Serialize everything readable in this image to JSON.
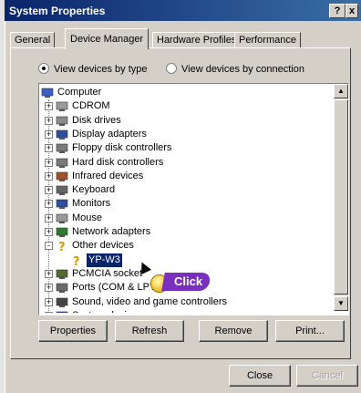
{
  "window": {
    "title": "System Properties",
    "help_button": "?",
    "close_button": "x"
  },
  "tabs": [
    "General",
    "Device Manager",
    "Hardware Profiles",
    "Performance"
  ],
  "radios": {
    "by_type": "View devices by type",
    "by_connection": "View devices by connection",
    "selected": "by_type"
  },
  "tree": [
    {
      "label": "Computer",
      "icon": "computer-icon",
      "level": 0
    },
    {
      "label": "CDROM",
      "icon": "cdrom-icon",
      "level": 1,
      "expander": "+"
    },
    {
      "label": "Disk drives",
      "icon": "disk-drive-icon",
      "level": 1,
      "expander": "+"
    },
    {
      "label": "Display adapters",
      "icon": "display-adapter-icon",
      "level": 1,
      "expander": "+"
    },
    {
      "label": "Floppy disk controllers",
      "icon": "floppy-controller-icon",
      "level": 1,
      "expander": "+"
    },
    {
      "label": "Hard disk controllers",
      "icon": "hard-disk-controller-icon",
      "level": 1,
      "expander": "+"
    },
    {
      "label": "Infrared devices",
      "icon": "infrared-icon",
      "level": 1,
      "expander": "+"
    },
    {
      "label": "Keyboard",
      "icon": "keyboard-icon",
      "level": 1,
      "expander": "+"
    },
    {
      "label": "Monitors",
      "icon": "monitor-icon",
      "level": 1,
      "expander": "+"
    },
    {
      "label": "Mouse",
      "icon": "mouse-icon",
      "level": 1,
      "expander": "+"
    },
    {
      "label": "Network adapters",
      "icon": "network-adapter-icon",
      "level": 1,
      "expander": "+"
    },
    {
      "label": "Other devices",
      "icon": "question-mark-icon",
      "level": 1,
      "expander": "-"
    },
    {
      "label": "YP-W3",
      "icon": "unknown-device-icon",
      "level": 2,
      "selected": true
    },
    {
      "label": "PCMCIA socket",
      "icon": "pcmcia-icon",
      "level": 1,
      "expander": "+"
    },
    {
      "label": "Ports (COM & LPT)",
      "icon": "port-icon",
      "level": 1,
      "expander": "+"
    },
    {
      "label": "Sound, video and game controllers",
      "icon": "sound-icon",
      "level": 1,
      "expander": "+"
    },
    {
      "label": "System devices",
      "icon": "system-devices-icon",
      "level": 1,
      "expander": "+"
    }
  ],
  "annotation": {
    "text": "Click"
  },
  "buttons": {
    "properties": "Properties",
    "refresh": "Refresh",
    "remove": "Remove",
    "print": "Print..."
  },
  "footer": {
    "close": "Close",
    "cancel": "Cancel"
  }
}
